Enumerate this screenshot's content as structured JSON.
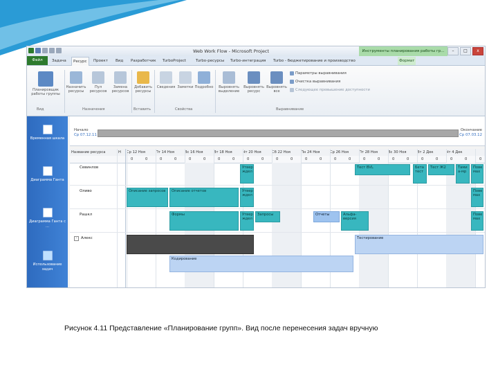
{
  "window": {
    "title": "Web Work Flow - Microsoft Project",
    "context_title": "Инструменты планирования работы гр...",
    "min": "–",
    "max": "□",
    "close": "x"
  },
  "tabs": [
    "Файл",
    "Задача",
    "Ресурс",
    "Проект",
    "Вид",
    "Разработчик",
    "TurboProject",
    "Turbo-ресурсы",
    "Turbo-интеграция",
    "Turbo - бюджетирование и производство",
    "Формат"
  ],
  "ribbon": {
    "buttons": {
      "team_planner": "Планировщик работы группы",
      "assign": "Назначить ресурсы",
      "pool": "Пул ресурсов",
      "replace": "Замена ресурсов",
      "add": "Добавить ресурсы",
      "info": "Сведения",
      "notes": "Заметки",
      "details": "Подробно",
      "level_sel": "Выровнять выделение",
      "level_res": "Выровнять ресурс",
      "level_all": "Выровнять все"
    },
    "leveling_items": [
      "Параметры выравнивания",
      "Очистка выравнивания",
      "Следующее превышение доступности"
    ],
    "groups": [
      "Вид",
      "Назначения",
      "Вставить",
      "Свойства",
      "Выравнивание"
    ]
  },
  "sidebar": [
    "Временная шкала",
    "Диаграмма Ганта",
    "Диаграмма Ганта с ...",
    "Использование задач"
  ],
  "timeline": {
    "start_label": "Начало",
    "start_date": "Ср 07.12.11",
    "end_label": "Окончание",
    "end_date": "Ср 07.03.12"
  },
  "grid": {
    "header_name": "Название ресурса",
    "header_h": "Н",
    "dates": [
      "Ср 12 Ноя",
      "Пт 14 Ноя",
      "Вс 16 Ноя",
      "Вт 18 Ноя",
      "Чт 20 Ноя",
      "Сб 22 Ноя",
      "Пн 24 Ноя",
      "Ср 26 Ноя",
      "Пт 28 Ноя",
      "Вс 30 Ноя",
      "Вт 2 Дек",
      "Чт 4 Дек"
    ],
    "sub_values": [
      "0",
      "0",
      "0",
      "0",
      "0",
      "0",
      "0",
      "0",
      "0",
      "0",
      "0",
      "0",
      "0",
      "0",
      "0",
      "0",
      "0",
      "0",
      "0",
      "0",
      "0",
      "0",
      "0",
      "0",
      "0",
      "0",
      "0",
      "0"
    ],
    "resources": [
      "Севинлов",
      "Оливо",
      "Рашкл",
      "Алекс"
    ],
    "bars": {
      "r1": [
        "Утвер ждел",
        "Тест BVL",
        "Бета тест",
        "Тест Ж2",
        "Тами а-мр",
        "Пове мах"
      ],
      "r2": [
        "Описание запросов",
        "Описание отчетов",
        "Утвер ждел",
        "Пове мах"
      ],
      "r3": [
        "Формы",
        "Утвер ждел",
        "Запросы",
        "Отчеты",
        "Альфа-версия",
        "Пове мах"
      ],
      "r4": [
        "Тестирование",
        "Кодирование"
      ]
    }
  },
  "caption": "Рисунок 4.11 Представление «Планирование групп». Вид после перенесения задач вручную",
  "colors": {
    "accent": "#2e6bbf",
    "file_tab": "#2d7a2d",
    "bar": "#38b7bf",
    "context": "#a9dba9"
  }
}
